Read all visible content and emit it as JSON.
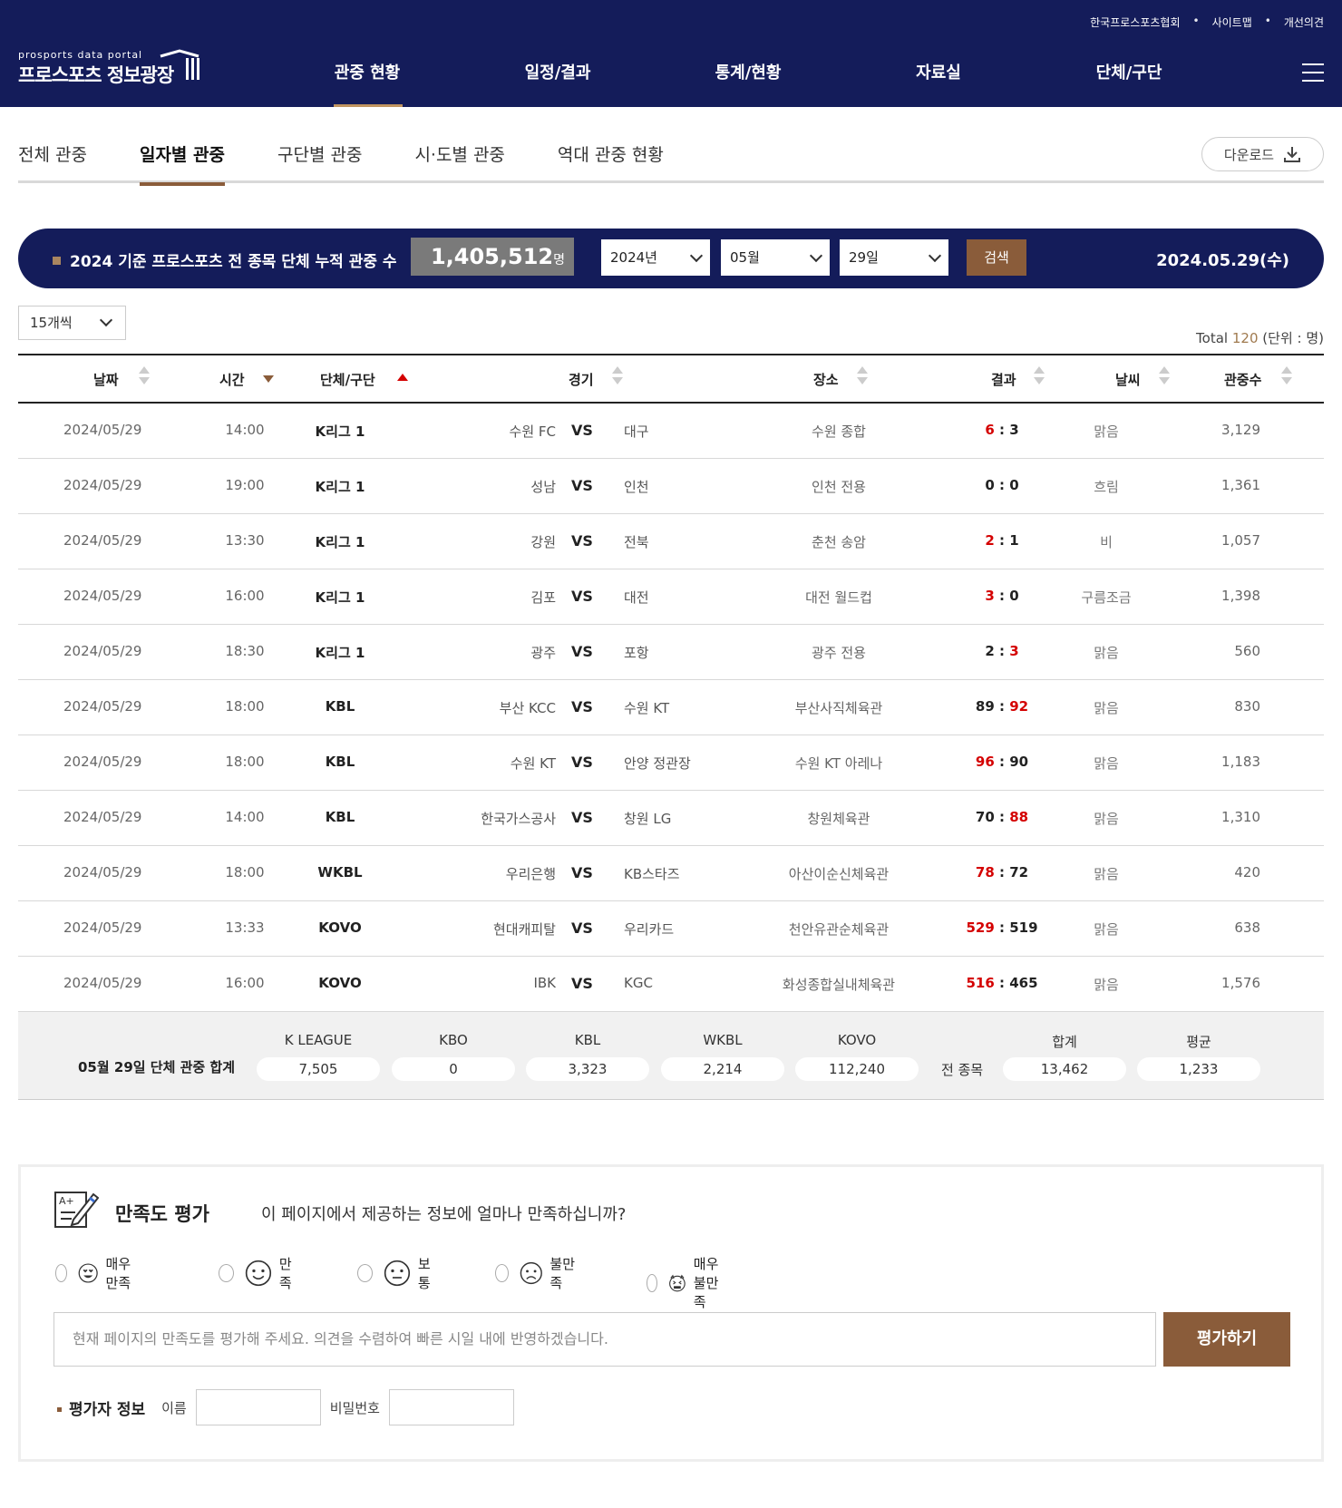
{
  "header": {
    "util_links": [
      "한국프로스포츠협회",
      "사이트맵",
      "개선의견"
    ],
    "logo_en": "prosports data portal",
    "logo_ko": "프로스포츠 정보광장",
    "gnb": [
      "관중 현황",
      "일정/결과",
      "통계/현황",
      "자료실",
      "단체/구단"
    ]
  },
  "tabs": [
    "전체 관중",
    "일자별 관중",
    "구단별 관중",
    "시·도별 관중",
    "역대 관중 현황"
  ],
  "download_label": "다운로드",
  "search_bar": {
    "label": "2024 기준 프로스포츠 전 종목 단체 누적 관중 수",
    "count": "1,405,512",
    "count_unit": "명",
    "year": "2024년",
    "month": "05월",
    "day": "29일",
    "search_label": "검색",
    "date_display": "2024.05.29(수)"
  },
  "per_page": "15개씩",
  "total": {
    "prefix": "Total",
    "value": "120",
    "unit": "(단위 : 명)"
  },
  "table": {
    "headers": [
      "날짜",
      "시간",
      "단체/구단",
      "경기",
      "장소",
      "결과",
      "날씨",
      "관중수"
    ],
    "vs_label": "VS",
    "rows": [
      {
        "date": "2024/05/29",
        "time": "14:00",
        "league": "K리그 1",
        "home": "수원 FC",
        "away": "대구",
        "venue": "수원 종합",
        "s1": "6",
        "s2": "3",
        "win": 1,
        "weather": "맑음",
        "aud": "3,129"
      },
      {
        "date": "2024/05/29",
        "time": "19:00",
        "league": "K리그 1",
        "home": "성남",
        "away": "인천",
        "venue": "인천 전용",
        "s1": "0",
        "s2": "0",
        "win": 0,
        "weather": "흐림",
        "aud": "1,361"
      },
      {
        "date": "2024/05/29",
        "time": "13:30",
        "league": "K리그 1",
        "home": "강원",
        "away": "전북",
        "venue": "춘천 송암",
        "s1": "2",
        "s2": "1",
        "win": 1,
        "weather": "비",
        "aud": "1,057"
      },
      {
        "date": "2024/05/29",
        "time": "16:00",
        "league": "K리그 1",
        "home": "김포",
        "away": "대전",
        "venue": "대전 월드컵",
        "s1": "3",
        "s2": "0",
        "win": 1,
        "weather": "구름조금",
        "aud": "1,398"
      },
      {
        "date": "2024/05/29",
        "time": "18:30",
        "league": "K리그 1",
        "home": "광주",
        "away": "포항",
        "venue": "광주 전용",
        "s1": "2",
        "s2": "3",
        "win": 2,
        "weather": "맑음",
        "aud": "560"
      },
      {
        "date": "2024/05/29",
        "time": "18:00",
        "league": "KBL",
        "home": "부산 KCC",
        "away": "수원 KT",
        "venue": "부산사직체육관",
        "s1": "89",
        "s2": "92",
        "win": 2,
        "weather": "맑음",
        "aud": "830"
      },
      {
        "date": "2024/05/29",
        "time": "18:00",
        "league": "KBL",
        "home": "수원 KT",
        "away": "안양 정관장",
        "venue": "수원 KT 아레나",
        "s1": "96",
        "s2": "90",
        "win": 1,
        "weather": "맑음",
        "aud": "1,183"
      },
      {
        "date": "2024/05/29",
        "time": "14:00",
        "league": "KBL",
        "home": "한국가스공사",
        "away": "창원 LG",
        "venue": "창원체육관",
        "s1": "70",
        "s2": "88",
        "win": 2,
        "weather": "맑음",
        "aud": "1,310"
      },
      {
        "date": "2024/05/29",
        "time": "18:00",
        "league": "WKBL",
        "home": "우리은행",
        "away": "KB스타즈",
        "venue": "아산이순신체육관",
        "s1": "78",
        "s2": "72",
        "win": 1,
        "weather": "맑음",
        "aud": "420"
      },
      {
        "date": "2024/05/29",
        "time": "13:33",
        "league": "KOVO",
        "home": "현대캐피탈",
        "away": "우리카드",
        "venue": "천안유관순체육관",
        "s1": "529",
        "s2": "519",
        "win": 1,
        "weather": "맑음",
        "aud": "638"
      },
      {
        "date": "2024/05/29",
        "time": "16:00",
        "league": "KOVO",
        "home": "IBK",
        "away": "KGC",
        "venue": "화성종합실내체육관",
        "s1": "516",
        "s2": "465",
        "win": 1,
        "weather": "맑음",
        "aud": "1,576"
      }
    ]
  },
  "summary": {
    "title": "05월 29일 단체 관중 합계",
    "cols": [
      {
        "h": "K LEAGUE",
        "v": "7,505"
      },
      {
        "h": "KBO",
        "v": "0"
      },
      {
        "h": "KBL",
        "v": "3,323"
      },
      {
        "h": "WKBL",
        "v": "2,214"
      },
      {
        "h": "KOVO",
        "v": "112,240"
      }
    ],
    "all_label": "전 종목",
    "total": {
      "h": "합계",
      "v": "13,462"
    },
    "avg": {
      "h": "평균",
      "v": "1,233"
    }
  },
  "survey": {
    "title": "만족도 평가",
    "question": "이 페이지에서 제공하는 정보에 얼마나 만족하십니까?",
    "options": [
      "매우만족",
      "만족",
      "보통",
      "불만족",
      "매우불만족"
    ],
    "input_placeholder": "현재 페이지의 만족도를 평가해 주세요. 의견을 수렴하여 빠른 시일 내에 반영하겠습니다.",
    "submit_label": "평가하기",
    "info_label": "평가자 정보",
    "name_label": "이름",
    "password_label": "비밀번호"
  },
  "colors": {
    "navy": "#141c5a",
    "brown": "#8a5c3a",
    "win_red": "#d40000"
  }
}
